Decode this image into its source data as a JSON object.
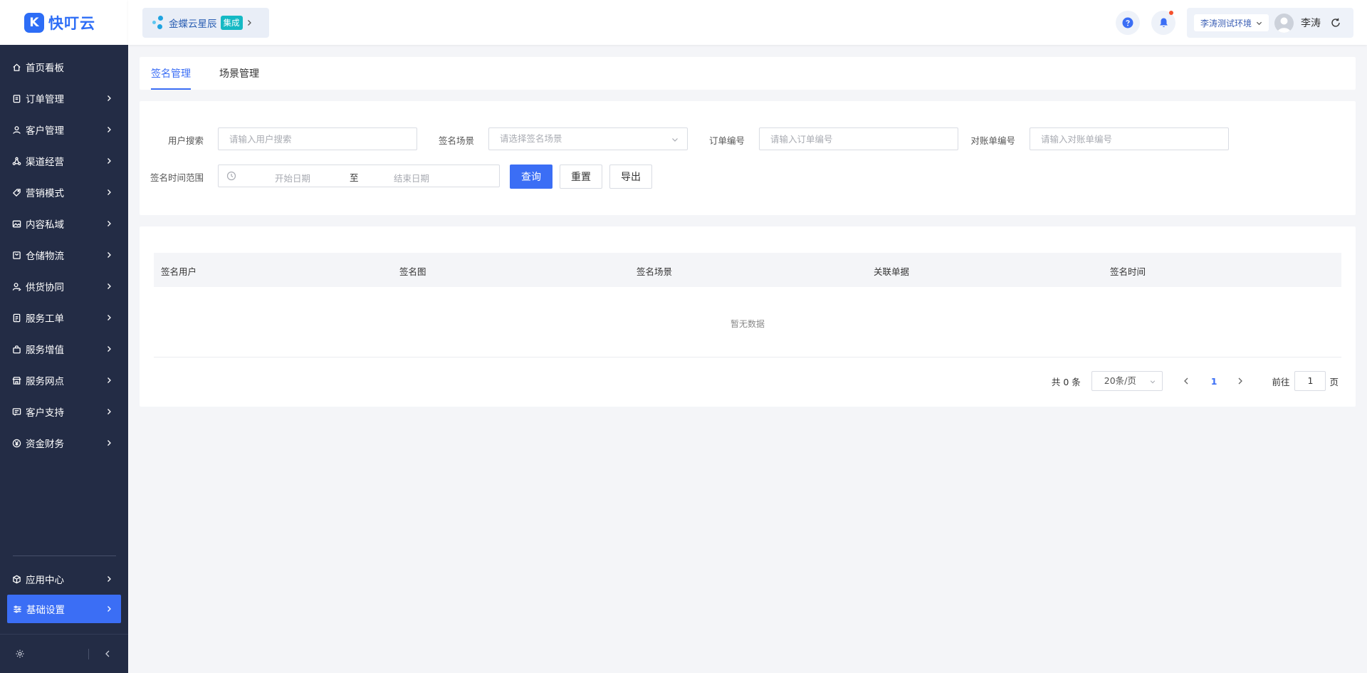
{
  "app": {
    "logo_glyph": "K",
    "logo_text": "快叮云",
    "brand_color": "#2d6df6"
  },
  "sidebar": {
    "items": [
      {
        "label": "首页看板",
        "icon": "home-icon",
        "has_arrow": false
      },
      {
        "label": "订单管理",
        "icon": "clipboard-icon",
        "has_arrow": true
      },
      {
        "label": "客户管理",
        "icon": "user-icon",
        "has_arrow": true
      },
      {
        "label": "渠道经营",
        "icon": "channel-icon",
        "has_arrow": true
      },
      {
        "label": "营销模式",
        "icon": "tag-icon",
        "has_arrow": true
      },
      {
        "label": "内容私域",
        "icon": "image-icon",
        "has_arrow": true
      },
      {
        "label": "仓储物流",
        "icon": "box-icon",
        "has_arrow": true
      },
      {
        "label": "供货协同",
        "icon": "supply-icon",
        "has_arrow": true
      },
      {
        "label": "服务工单",
        "icon": "ticket-icon",
        "has_arrow": true
      },
      {
        "label": "服务增值",
        "icon": "bag-icon",
        "has_arrow": true
      },
      {
        "label": "服务网点",
        "icon": "store-icon",
        "has_arrow": true
      },
      {
        "label": "客户支持",
        "icon": "support-icon",
        "has_arrow": true
      },
      {
        "label": "资金财务",
        "icon": "yuan-icon",
        "has_arrow": true
      }
    ],
    "bottom_items": [
      {
        "label": "应用中心",
        "icon": "cube-icon"
      },
      {
        "label": "基础设置",
        "icon": "sliders-icon",
        "active": true
      }
    ],
    "bg_color": "#232c45",
    "active_color": "#3b6ef5"
  },
  "header": {
    "brand_name": "金蝶云星辰",
    "brand_tag": "集成",
    "env_label": "李涛测试环境",
    "user_name": "李涛"
  },
  "tabs": [
    {
      "label": "签名管理",
      "active": true
    },
    {
      "label": "场景管理",
      "active": false
    }
  ],
  "filters": {
    "user_search": {
      "label": "用户搜索",
      "placeholder": "请输入用户搜索"
    },
    "sign_scene": {
      "label": "签名场景",
      "placeholder": "请选择签名场景"
    },
    "order_no": {
      "label": "订单编号",
      "placeholder": "请输入订单编号"
    },
    "statement_no": {
      "label": "对账单编号",
      "placeholder": "请输入对账单编号"
    },
    "time_range": {
      "label": "签名时间范围",
      "start": "开始日期",
      "separator": "至",
      "end": "结束日期"
    },
    "buttons": {
      "query": "查询",
      "reset": "重置",
      "export": "导出"
    }
  },
  "table": {
    "columns": [
      "签名用户",
      "签名图",
      "签名场景",
      "关联单据",
      "签名时间"
    ],
    "empty_text": "暂无数据"
  },
  "pagination": {
    "total": "共 0 条",
    "page_size": "20条/页",
    "current_page": "1",
    "goto_label": "前往",
    "goto_value": "1",
    "page_suffix": "页"
  }
}
